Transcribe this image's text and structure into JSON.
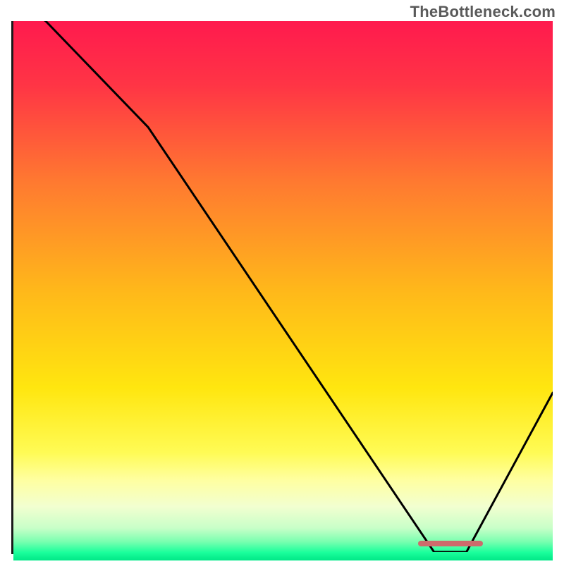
{
  "watermark": "TheBottleneck.com",
  "colors": {
    "axis": "#1a1a1a",
    "curve": "#000000",
    "marker": "#cd6b6c",
    "gradient_stops": [
      {
        "offset": 0.0,
        "color": "#ff1a4e"
      },
      {
        "offset": 0.12,
        "color": "#ff3545"
      },
      {
        "offset": 0.3,
        "color": "#ff7a30"
      },
      {
        "offset": 0.5,
        "color": "#ffb81a"
      },
      {
        "offset": 0.68,
        "color": "#ffe60f"
      },
      {
        "offset": 0.8,
        "color": "#fffb55"
      },
      {
        "offset": 0.85,
        "color": "#ffffa0"
      },
      {
        "offset": 0.9,
        "color": "#f2ffd0"
      },
      {
        "offset": 0.94,
        "color": "#c8ffc8"
      },
      {
        "offset": 0.965,
        "color": "#7affb0"
      },
      {
        "offset": 0.985,
        "color": "#1bff9c"
      },
      {
        "offset": 1.0,
        "color": "#00e887"
      }
    ]
  },
  "chart_data": {
    "type": "line",
    "title": "",
    "xlabel": "",
    "ylabel": "",
    "xlim": [
      0,
      100
    ],
    "ylim": [
      0,
      100
    ],
    "series": [
      {
        "name": "bottleneck-curve",
        "x": [
          0,
          6,
          25,
          78,
          84,
          100
        ],
        "values": [
          104,
          100,
          80,
          0,
          0,
          30
        ]
      }
    ],
    "marker": {
      "x_start": 75,
      "x_end": 87,
      "y": 1
    }
  }
}
